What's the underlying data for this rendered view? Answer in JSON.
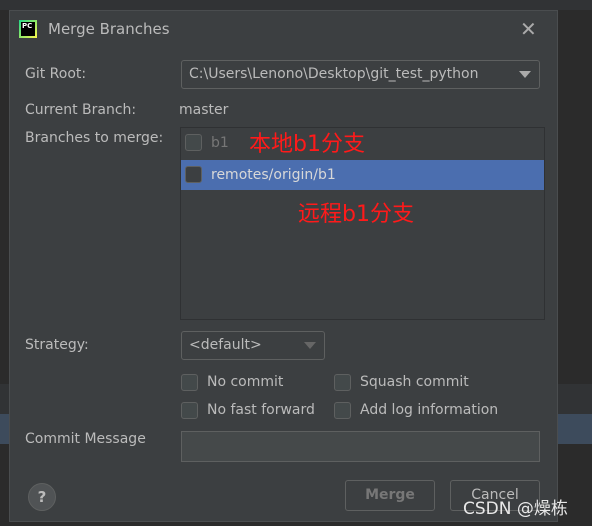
{
  "dialog": {
    "title": "Merge Branches",
    "logo_text": "PC",
    "close_icon": "close-icon"
  },
  "form": {
    "git_root_label": "Git Root:",
    "git_root_value": "C:\\Users\\Lenono\\Desktop\\git_test_python",
    "current_branch_label": "Current Branch:",
    "current_branch_value": "master",
    "branches_label": "Branches to merge:",
    "branches": [
      {
        "name": "b1",
        "checked": false,
        "selected": false
      },
      {
        "name": "remotes/origin/b1",
        "checked": false,
        "selected": true
      }
    ],
    "strategy_label": "Strategy:",
    "strategy_value": "<default>",
    "options": [
      {
        "label": "No commit",
        "checked": false
      },
      {
        "label": "Squash commit",
        "checked": false
      },
      {
        "label": "No fast forward",
        "checked": false
      },
      {
        "label": "Add log information",
        "checked": false
      }
    ],
    "commit_message_label": "Commit Message",
    "commit_message_value": ""
  },
  "annotations": {
    "local": "本地b1分支",
    "remote": "远程b1分支"
  },
  "buttons": {
    "help": "?",
    "merge": "Merge",
    "cancel": "Cancel"
  },
  "watermark": "CSDN @燥栋",
  "colors": {
    "selection": "#4b6eaf",
    "annotation": "#ff1a1a",
    "dialog_bg": "#3c3f41"
  }
}
